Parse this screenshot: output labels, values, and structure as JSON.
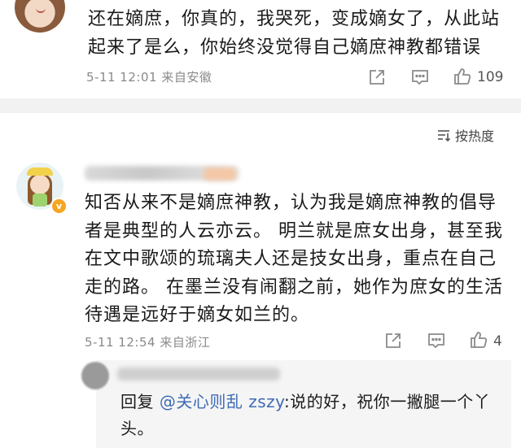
{
  "comment1": {
    "text": "还在嫡庶，你真的，我哭死，变成嫡女了，从此站起来了是么，你始终没觉得自己嫡庶神教都错误",
    "time": "5-11 12:01",
    "location": "来自安徽",
    "like_count": "109",
    "icons": [
      "share-icon",
      "comment-icon",
      "like-icon"
    ]
  },
  "sort": {
    "label": "按热度"
  },
  "comment2": {
    "text": "知否从来不是嫡庶神教，认为我是嫡庶神教的倡导者是典型的人云亦云。 明兰就是庶女出身，甚至我在文中歌颂的琉璃夫人还是技女出身，重点在自己走的路。 在墨兰没有闹翻之前，她作为庶女的生活待遇是远好于嫡女如兰的。",
    "time": "5-11 12:54",
    "location": "来自浙江",
    "like_count": "4",
    "badge": "v"
  },
  "reply": {
    "prefix": "回复",
    "mention": "@关心则乱 zszy",
    "text": ":说的好，祝你一撇腿一个丫头。"
  }
}
